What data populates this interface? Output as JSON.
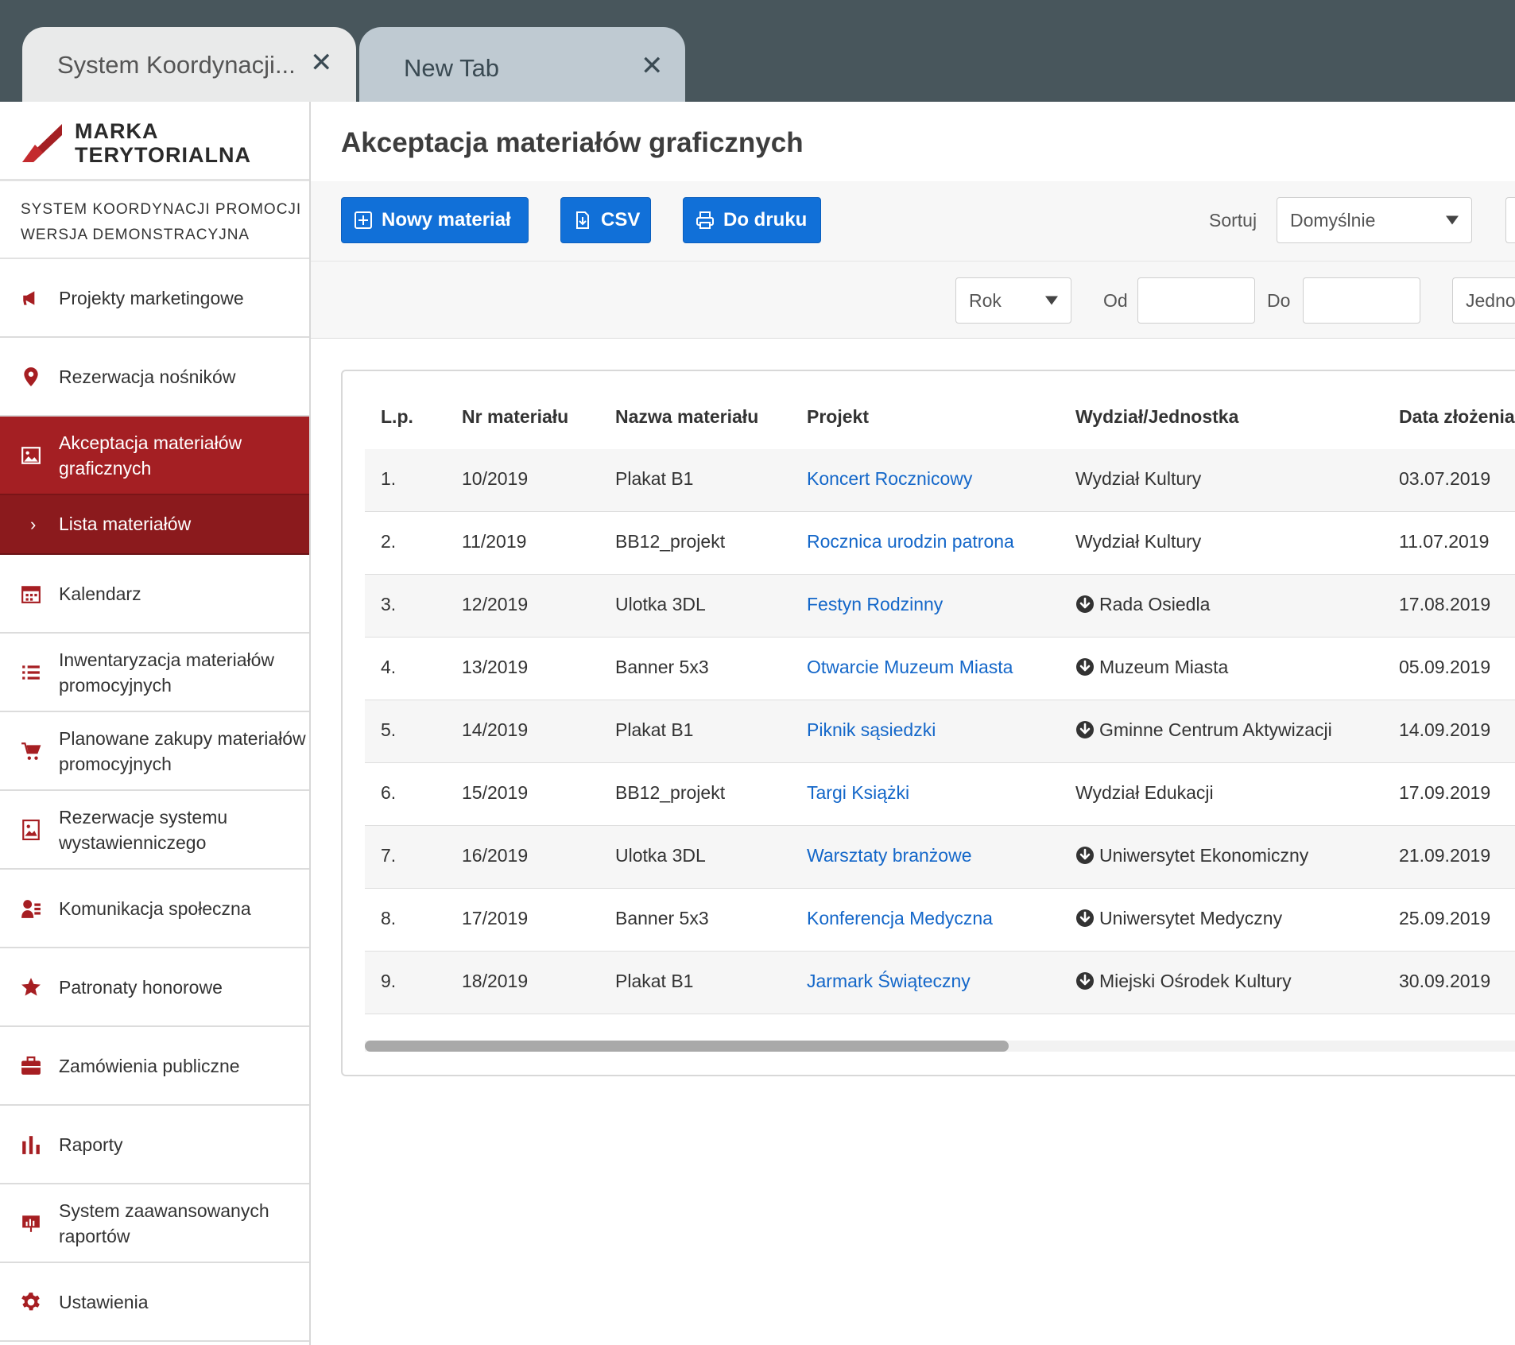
{
  "browser": {
    "tabs": [
      {
        "title": "System Koordynacji..."
      },
      {
        "title": "New Tab"
      }
    ]
  },
  "brand": {
    "line1": "MARKA",
    "line2": "TERYTORIALNA",
    "color": "#a41f23"
  },
  "system": {
    "line1": "SYSTEM KOORDYNACJI PROMOCJI",
    "line2": "WERSJA DEMONSTRACYJNA"
  },
  "sidebar": {
    "items": [
      {
        "label": "Projekty marketingowe",
        "icon": "megaphone-icon"
      },
      {
        "label": "Rezerwacja nośników",
        "icon": "map-pin-icon"
      },
      {
        "label": "Akceptacja materiałów graficznych",
        "icon": "image-icon",
        "active": true
      },
      {
        "label": "Kalendarz",
        "icon": "calendar-icon"
      },
      {
        "label": "Inwentaryzacja materiałów promocyjnych",
        "icon": "list-icon"
      },
      {
        "label": "Planowane zakupy materiałów promocyjnych",
        "icon": "cart-icon"
      },
      {
        "label": "Rezerwacje systemu wystawienniczego",
        "icon": "easel-icon"
      },
      {
        "label": "Komunikacja społeczna",
        "icon": "people-icon"
      },
      {
        "label": "Patronaty honorowe",
        "icon": "star-icon"
      },
      {
        "label": "Zamówienia publiczne",
        "icon": "briefcase-icon"
      },
      {
        "label": "Raporty",
        "icon": "bar-chart-icon"
      },
      {
        "label": "System zaawansowanych raportów",
        "icon": "presentation-icon"
      },
      {
        "label": "Ustawienia",
        "icon": "gear-icon"
      }
    ],
    "subitem": "Lista materiałów"
  },
  "main": {
    "title": "Akceptacja materiałów graficznych",
    "buttons": {
      "new": "Nowy materiał",
      "csv": "CSV",
      "print": "Do druku"
    },
    "sort_label": "Sortuj",
    "sort_value": "Domyślnie",
    "filters": {
      "year": "Rok",
      "from_label": "Od",
      "to_label": "Do",
      "unit_partial": "Jedno"
    },
    "table": {
      "headers": [
        "L.p.",
        "Nr materiału",
        "Nazwa materiału",
        "Projekt",
        "Wydział/Jednostka",
        "Data złożenia"
      ],
      "rows": [
        {
          "lp": "1.",
          "nr": "10/2019",
          "name": "Plakat B1",
          "project": "Koncert Rocznicowy",
          "unit": "Wydział Kultury",
          "date": "03.07.2019",
          "sub": false
        },
        {
          "lp": "2.",
          "nr": "11/2019",
          "name": "BB12_projekt",
          "project": "Rocznica urodzin patrona",
          "unit": "Wydział Kultury",
          "date": "11.07.2019",
          "sub": false
        },
        {
          "lp": "3.",
          "nr": "12/2019",
          "name": "Ulotka 3DL",
          "project": "Festyn Rodzinny",
          "unit": "Rada Osiedla",
          "date": "17.08.2019",
          "sub": true
        },
        {
          "lp": "4.",
          "nr": "13/2019",
          "name": "Banner 5x3",
          "project": "Otwarcie Muzeum Miasta",
          "unit": "Muzeum Miasta",
          "date": "05.09.2019",
          "sub": true
        },
        {
          "lp": "5.",
          "nr": "14/2019",
          "name": "Plakat B1",
          "project": "Piknik sąsiedzki",
          "unit": "Gminne Centrum Aktywizacji",
          "date": "14.09.2019",
          "sub": true
        },
        {
          "lp": "6.",
          "nr": "15/2019",
          "name": "BB12_projekt",
          "project": "Targi Książki",
          "unit": "Wydział Edukacji",
          "date": "17.09.2019",
          "sub": false
        },
        {
          "lp": "7.",
          "nr": "16/2019",
          "name": "Ulotka 3DL",
          "project": "Warsztaty branżowe",
          "unit": "Uniwersytet Ekonomiczny",
          "date": "21.09.2019",
          "sub": true
        },
        {
          "lp": "8.",
          "nr": "17/2019",
          "name": "Banner 5x3",
          "project": "Konferencja Medyczna",
          "unit": "Uniwersytet Medyczny",
          "date": "25.09.2019",
          "sub": true
        },
        {
          "lp": "9.",
          "nr": "18/2019",
          "name": "Plakat B1",
          "project": "Jarmark Świąteczny",
          "unit": "Miejski Ośrodek Kultury",
          "date": "30.09.2019",
          "sub": true
        }
      ]
    }
  }
}
